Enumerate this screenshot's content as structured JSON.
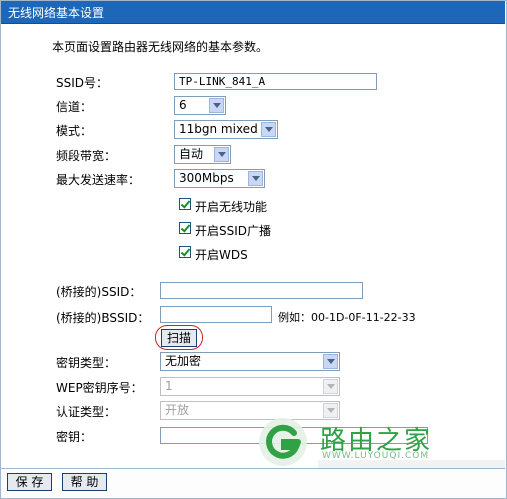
{
  "title": "无线网络基本设置",
  "intro": "本页面设置路由器无线网络的基本参数。",
  "ssid": {
    "label": "SSID号：",
    "value": "TP-LINK_841_A"
  },
  "channel": {
    "label": "信道：",
    "value": "6"
  },
  "mode": {
    "label": "模式：",
    "value": "11bgn mixed"
  },
  "bandwidth": {
    "label": "频段带宽：",
    "value": "自动"
  },
  "max_rate": {
    "label": "最大发送速率：",
    "value": "300Mbps"
  },
  "checkboxes": [
    {
      "label": "开启无线功能",
      "checked": true
    },
    {
      "label": "开启SSID广播",
      "checked": true
    },
    {
      "label": "开启WDS",
      "checked": true
    }
  ],
  "bridge_ssid": {
    "label": "(桥接的)SSID：",
    "value": ""
  },
  "bridge_bssid": {
    "label": "(桥接的)BSSID：",
    "value": "",
    "example": "例如：00-1D-0F-11-22-33"
  },
  "scan_button": "扫描",
  "key_type": {
    "label": "密钥类型：",
    "value": "无加密"
  },
  "wep_index": {
    "label": "WEP密钥序号：",
    "value": "1"
  },
  "auth_type": {
    "label": "认证类型：",
    "value": "开放"
  },
  "key": {
    "label": "密钥：",
    "value": ""
  },
  "buttons": {
    "save": "保 存",
    "help": "帮 助"
  },
  "watermark": {
    "text": "路由之家",
    "url": "WWW.LUYOUQI.COM"
  },
  "colors": {
    "titlebar": "#1e67b8",
    "border": "#9fb6cd",
    "watermark": "#2ea244",
    "scan_ring": "#d12020"
  }
}
